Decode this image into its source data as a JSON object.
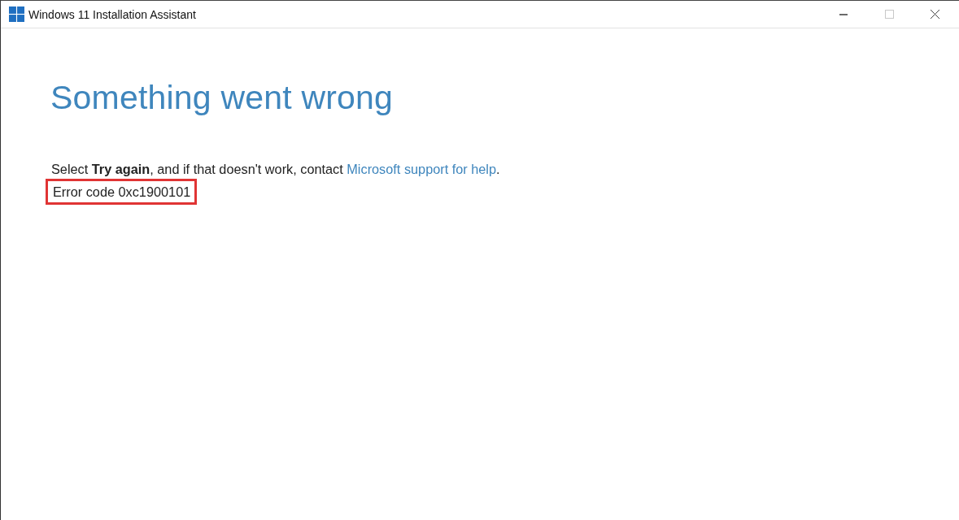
{
  "window": {
    "title": "Windows 11 Installation Assistant",
    "controls": [
      {
        "kind": "minimize",
        "disabled": false
      },
      {
        "kind": "maximize",
        "disabled": true
      },
      {
        "kind": "close",
        "disabled": false
      }
    ]
  },
  "heading": "Something went wrong",
  "message": {
    "text": "Select **Try again**, and if that doesn't work, contact",
    "link": "Microsoft support for help",
    "end": "."
  },
  "error": {
    "text": "Error code 0xc1900101",
    "highlighted": true
  }
}
